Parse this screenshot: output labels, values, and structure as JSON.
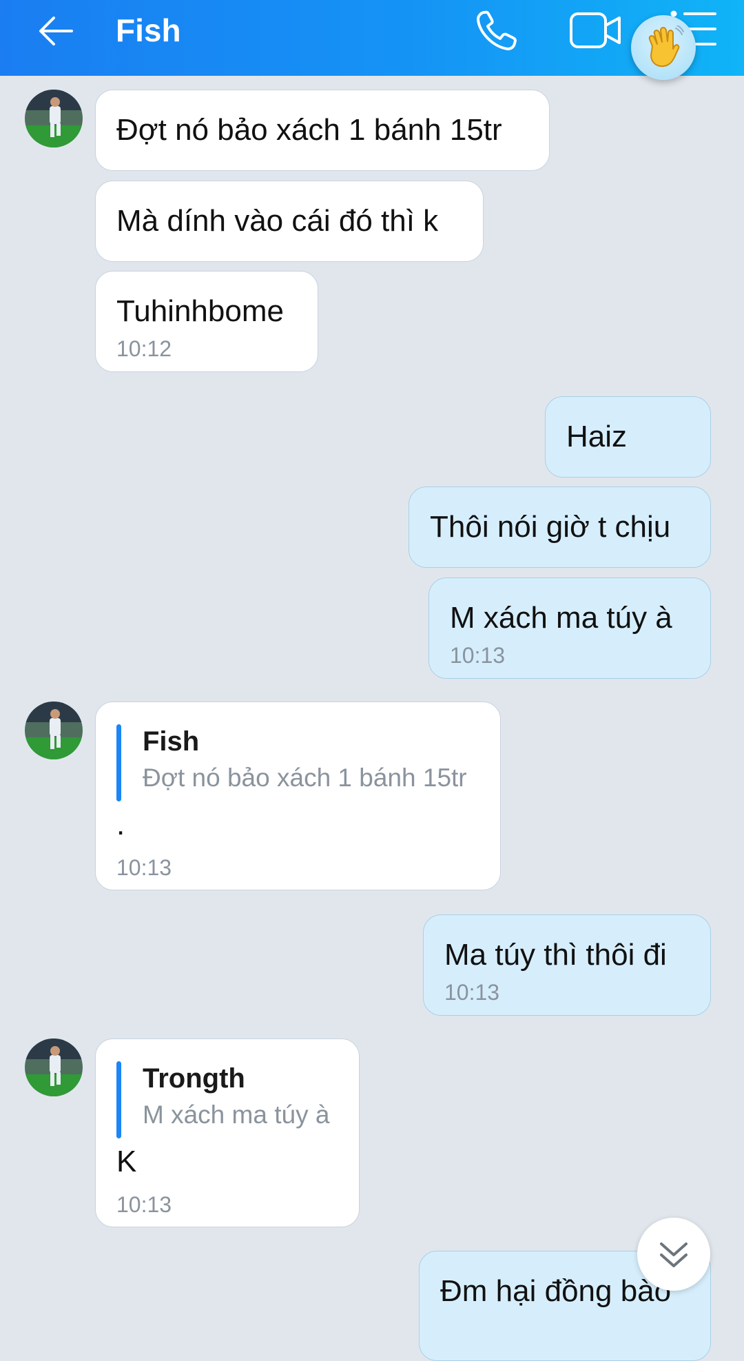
{
  "header": {
    "title": "Fish",
    "icons": [
      "back-arrow-icon",
      "phone-icon",
      "video-call-icon",
      "menu-list-icon",
      "waving-hand-icon"
    ]
  },
  "colors": {
    "header_start": "#1a7ef2",
    "header_end": "#10b4f7",
    "chat_background": "#e1e6ed",
    "incoming_bubble": "#ffffff",
    "outgoing_bubble": "#d6eefc",
    "quote_bar": "#1b86f5",
    "timestamp": "#8a939d"
  },
  "messages": [
    {
      "direction": "in",
      "text": "Đợt nó bảo xách 1 bánh 15tr"
    },
    {
      "direction": "in",
      "text": "Mà dính vào cái đó thì k"
    },
    {
      "direction": "in",
      "text": "Tuhinhbome",
      "time": "10:12"
    },
    {
      "direction": "out",
      "text": "Haiz"
    },
    {
      "direction": "out",
      "text": "Thôi nói giờ t chịu"
    },
    {
      "direction": "out",
      "text": "M xách ma túy à",
      "time": "10:13"
    },
    {
      "direction": "in",
      "quote_name": "Fish",
      "quote_text": "Đợt nó bảo xách 1 bánh 15tr",
      "text": ".",
      "time": "10:13"
    },
    {
      "direction": "out",
      "text": "Ma túy thì thôi đi",
      "time": "10:13"
    },
    {
      "direction": "in",
      "quote_name": "Trongth",
      "quote_text": "M xách ma túy à",
      "text": "K",
      "time": "10:13"
    },
    {
      "direction": "out",
      "text": "Đm hại đồng bào"
    }
  ]
}
